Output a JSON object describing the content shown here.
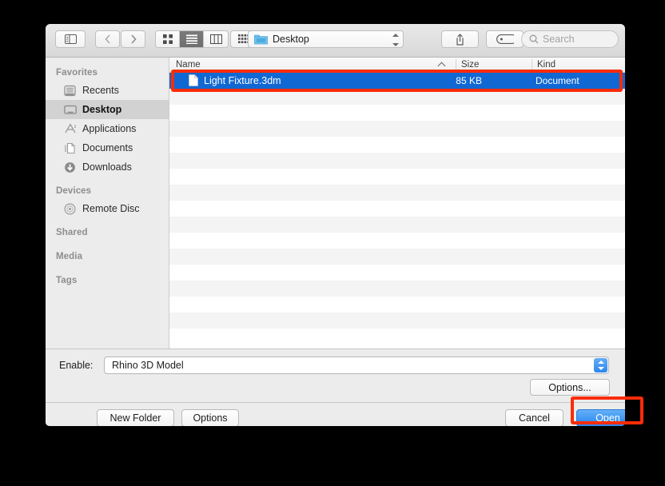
{
  "toolbar": {
    "sidebar_toggle_icon": "sidebar-toggle-icon",
    "back_icon": "chevron-left-icon",
    "forward_icon": "chevron-right-icon",
    "view_icon_grid": "grid-view-icon",
    "view_list": "list-view-icon",
    "view_column": "column-view-icon",
    "arrange_icon": "arrange-by-icon",
    "path_label": "Desktop",
    "path_icon": "folder-icon",
    "share_icon": "share-icon",
    "tag_icon": "tag-icon",
    "search_icon": "search-icon",
    "search_placeholder": "Search"
  },
  "sidebar": {
    "sections": [
      {
        "title": "Favorites",
        "items": [
          {
            "label": "Recents",
            "icon": "recents-icon",
            "selected": false
          },
          {
            "label": "Desktop",
            "icon": "desktop-icon",
            "selected": true
          },
          {
            "label": "Applications",
            "icon": "applications-icon",
            "selected": false
          },
          {
            "label": "Documents",
            "icon": "documents-icon",
            "selected": false
          },
          {
            "label": "Downloads",
            "icon": "downloads-icon",
            "selected": false
          }
        ]
      },
      {
        "title": "Devices",
        "items": [
          {
            "label": "Remote Disc",
            "icon": "disc-icon",
            "selected": false
          }
        ]
      },
      {
        "title": "Shared",
        "items": []
      },
      {
        "title": "Media",
        "items": []
      },
      {
        "title": "Tags",
        "items": []
      }
    ]
  },
  "filelist": {
    "columns": [
      "Name",
      "Size",
      "Kind"
    ],
    "sort_column": "Name",
    "sort_direction": "ascending",
    "rows": [
      {
        "name": "Light Fixture.3dm",
        "size": "85 KB",
        "kind": "Document",
        "selected": true
      }
    ],
    "empty_row_count": 16
  },
  "bottom": {
    "enable_label": "Enable:",
    "enable_value": "Rhino 3D Model",
    "options_dots_label": "Options...",
    "new_folder_label": "New Folder",
    "options_label": "Options",
    "cancel_label": "Cancel",
    "open_label": "Open"
  },
  "annotations": {
    "highlight_color": "#fb2c08",
    "selection_color": "#1268d3",
    "targets": [
      "selected-file-row",
      "open-button"
    ]
  }
}
